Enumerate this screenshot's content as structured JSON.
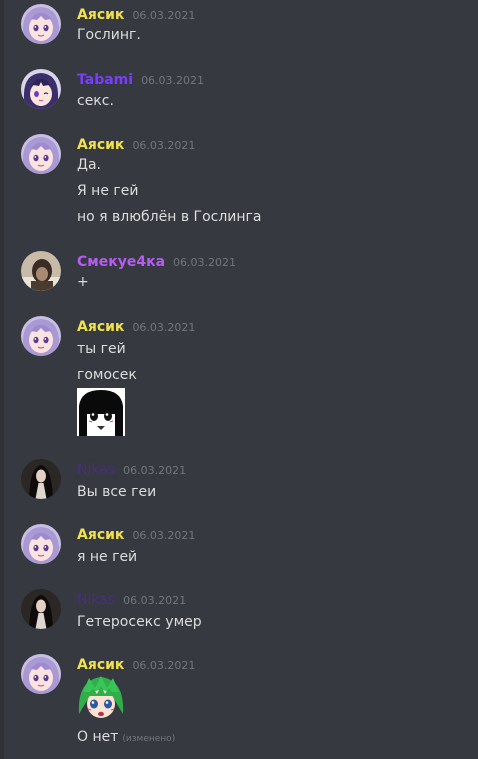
{
  "colors": {
    "background": "#36393f",
    "text": "#dcddde",
    "timestamp": "#72767d",
    "ayasik": "#f1e14c",
    "tabami": "#7a3cff",
    "smekue": "#b75cf2",
    "nikas": "#4b2a8c"
  },
  "messages": [
    {
      "author": "Аясик",
      "time": "06.03.2021",
      "lines": [
        "Гослинг."
      ]
    },
    {
      "author": "Tabami",
      "time": "06.03.2021",
      "lines": [
        "секс."
      ]
    },
    {
      "author": "Аясик",
      "time": "06.03.2021",
      "lines": [
        "Да.",
        "Я не гей",
        "но я влюблён в Гослинга"
      ]
    },
    {
      "author": "Смекуе4ка",
      "time": "06.03.2021",
      "lines": [
        "+"
      ]
    },
    {
      "author": "Аясик",
      "time": "06.03.2021",
      "lines": [
        "ты гей",
        "гомосек"
      ],
      "emote": "anime-girl-emote"
    },
    {
      "author": "Nikas",
      "time": "06.03.2021",
      "lines": [
        "Вы все геи"
      ]
    },
    {
      "author": "Аясик",
      "time": "06.03.2021",
      "lines": [
        "я не гей"
      ]
    },
    {
      "author": "Nikas",
      "time": "06.03.2021",
      "lines": [
        "Гетеросекс умер"
      ]
    },
    {
      "author": "Аясик",
      "time": "06.03.2021",
      "emote": "green-hair-anime-emote",
      "lines": [
        "О нет"
      ],
      "edited": "(изменено)"
    }
  ]
}
